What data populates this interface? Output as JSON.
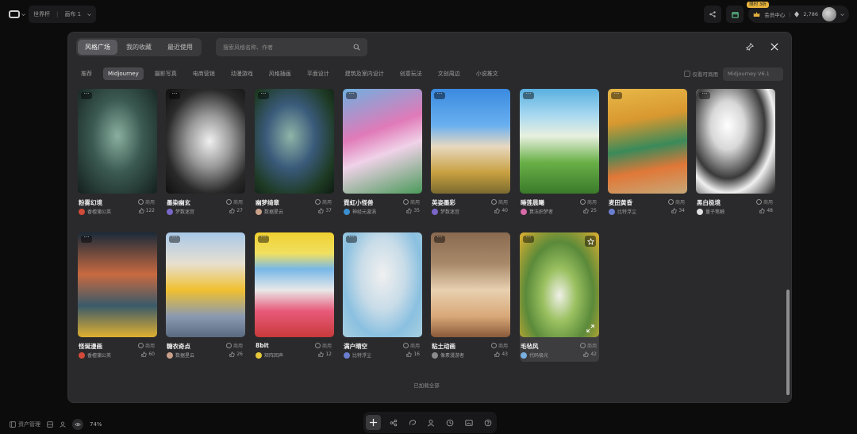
{
  "topbar": {
    "crumbs": [
      "世界杯",
      "画布 1"
    ],
    "member_badge": "限时 3折",
    "member_label": "会员中心",
    "points": "2,786"
  },
  "modal": {
    "tabs": [
      {
        "label": "风格广场",
        "active": true
      },
      {
        "label": "我的收藏",
        "active": false
      },
      {
        "label": "最近使用",
        "active": false
      }
    ],
    "search_placeholder": "搜索风格名称、作者",
    "categories": [
      {
        "label": "推荐",
        "active": false
      },
      {
        "label": "Midjourney",
        "active": true
      },
      {
        "label": "摄影写真",
        "active": false
      },
      {
        "label": "电商营销",
        "active": false
      },
      {
        "label": "动漫游戏",
        "active": false
      },
      {
        "label": "风格插画",
        "active": false
      },
      {
        "label": "平面设计",
        "active": false
      },
      {
        "label": "建筑及室内设计",
        "active": false
      },
      {
        "label": "创意玩法",
        "active": false
      },
      {
        "label": "文创周边",
        "active": false
      },
      {
        "label": "小说推文",
        "active": false
      }
    ],
    "filter_commercial": "仅看可商用",
    "model_select": "Midjourney V6.1",
    "loaded_text": "已加载全部"
  },
  "cards": [
    {
      "name": "粉雾幻境",
      "commercial": "商用",
      "author": "香檀蒲公英",
      "likes": "122",
      "author_color": "#d24a3a"
    },
    {
      "name": "墨染幽玄",
      "commercial": "商用",
      "author": "梦数迷宫",
      "likes": "27",
      "author_color": "#7a66c8"
    },
    {
      "name": "幽梦绮章",
      "commercial": "商用",
      "author": "数据星云",
      "likes": "37",
      "author_color": "#c9a08a"
    },
    {
      "name": "霓虹小怪兽",
      "commercial": "商用",
      "author": "神经元漩涡",
      "likes": "35",
      "author_color": "#3a8fd0"
    },
    {
      "name": "英姿墨彩",
      "commercial": "商用",
      "author": "梦数迷宫",
      "likes": "40",
      "author_color": "#7a66c8"
    },
    {
      "name": "睡莲晨曦",
      "commercial": "商用",
      "author": "算法织梦者",
      "likes": "25",
      "author_color": "#d86aa8"
    },
    {
      "name": "麦田黄昏",
      "commercial": "商用",
      "author": "比特浮尘",
      "likes": "34",
      "author_color": "#6a7ed0"
    },
    {
      "name": "黑白极境",
      "commercial": "商用",
      "author": "量子笔触",
      "likes": "48",
      "author_color": "#e0e0e0"
    },
    {
      "name": "怪诞漫画",
      "commercial": "商用",
      "author": "香檀蒲公英",
      "likes": "60",
      "author_color": "#d24a3a"
    },
    {
      "name": "糖衣奇点",
      "commercial": "商用",
      "author": "数据星云",
      "likes": "26",
      "author_color": "#c9a08a"
    },
    {
      "name": "8bit",
      "commercial": "商用",
      "author": "矩阵回声",
      "likes": "12",
      "author_color": "#e6c83a"
    },
    {
      "name": "满户晴空",
      "commercial": "商用",
      "author": "比特浮尘",
      "likes": "16",
      "author_color": "#6a7ed0"
    },
    {
      "name": "粘土动画",
      "commercial": "商用",
      "author": "像素漫游者",
      "likes": "43",
      "author_color": "#8a8a8a"
    },
    {
      "name": "毛毡风",
      "commercial": "商用",
      "author": "代码极光",
      "likes": "42",
      "author_color": "#7ab0e0"
    }
  ],
  "bottom": {
    "asset_label": "资产管理",
    "zoom": "74%"
  }
}
